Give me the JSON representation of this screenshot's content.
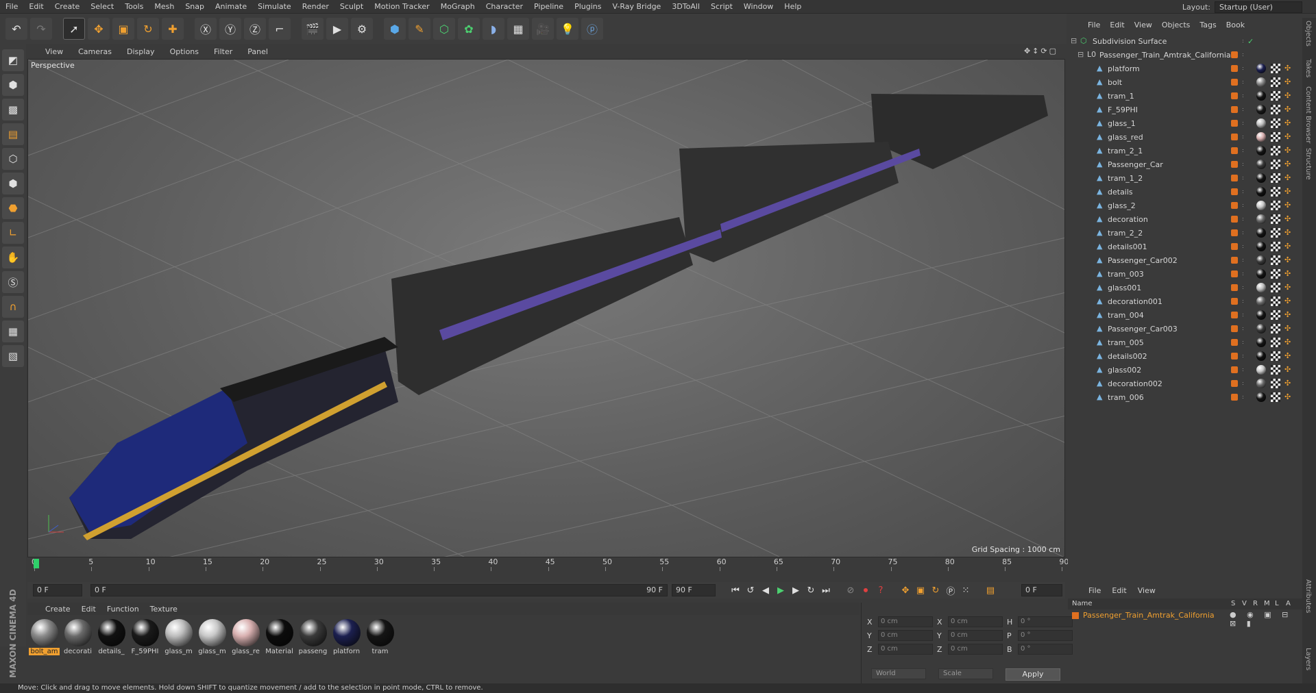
{
  "menubar": {
    "items": [
      "File",
      "Edit",
      "Create",
      "Select",
      "Tools",
      "Mesh",
      "Snap",
      "Animate",
      "Simulate",
      "Render",
      "Sculpt",
      "Motion Tracker",
      "MoGraph",
      "Character",
      "Pipeline",
      "Plugins",
      "V-Ray Bridge",
      "3DToAll",
      "Script",
      "Window",
      "Help"
    ],
    "layout_label": "Layout:",
    "layout_value": "Startup (User)"
  },
  "viewport": {
    "menu": [
      "View",
      "Cameras",
      "Display",
      "Options",
      "Filter",
      "Panel"
    ],
    "label": "Perspective",
    "grid_spacing": "Grid Spacing : 1000 cm"
  },
  "timeline": {
    "ticks": [
      "0",
      "5",
      "10",
      "15",
      "20",
      "25",
      "30",
      "35",
      "40",
      "45",
      "50",
      "55",
      "60",
      "65",
      "70",
      "75",
      "80",
      "85",
      "90"
    ],
    "current_frame_field": "0 F",
    "current_frame_right": "0 F",
    "range_start": "0 F",
    "range_end": "90 F",
    "range_end_field": "90 F"
  },
  "materials": {
    "menu": [
      "Create",
      "Edit",
      "Function",
      "Texture"
    ],
    "items": [
      {
        "label": "bolt_am",
        "color": "#8a8a8a"
      },
      {
        "label": "decorati",
        "color": "#6a6a6a"
      },
      {
        "label": "details_",
        "color": "#111111"
      },
      {
        "label": "F_59PHI",
        "color": "#1a1a1a"
      },
      {
        "label": "glass_m",
        "color": "#bdbdbd"
      },
      {
        "label": "glass_m",
        "color": "#c8c8c8"
      },
      {
        "label": "glass_re",
        "color": "#d8b0b0"
      },
      {
        "label": "Material",
        "color": "#0c0c0c"
      },
      {
        "label": "passeng",
        "color": "#3a3a3a"
      },
      {
        "label": "platforn",
        "color": "#1c2050"
      },
      {
        "label": "tram",
        "color": "#151515"
      }
    ]
  },
  "coords": {
    "rows": [
      {
        "a": "X",
        "v1": "0 cm",
        "b": "X",
        "v2": "0 cm",
        "c": "H",
        "v3": "0 °"
      },
      {
        "a": "Y",
        "v1": "0 cm",
        "b": "Y",
        "v2": "0 cm",
        "c": "P",
        "v3": "0 °"
      },
      {
        "a": "Z",
        "v1": "0 cm",
        "b": "Z",
        "v2": "0 cm",
        "c": "B",
        "v3": "0 °"
      }
    ],
    "world": "World",
    "scale": "Scale",
    "apply": "Apply"
  },
  "object_manager": {
    "menu": [
      "File",
      "Edit",
      "View",
      "Objects",
      "Tags",
      "Book"
    ],
    "root": "Subdivision Surface",
    "group": "Passenger_Train_Amtrak_California",
    "items": [
      {
        "name": "platform",
        "mat": "#1c2050"
      },
      {
        "name": "bolt",
        "mat": "#8a8a8a"
      },
      {
        "name": "tram_1",
        "mat": "#151515"
      },
      {
        "name": "F_59PHI",
        "mat": "#1a1a1a"
      },
      {
        "name": "glass_1",
        "mat": "#bdbdbd"
      },
      {
        "name": "glass_red",
        "mat": "#d8b0b0"
      },
      {
        "name": "tram_2_1",
        "mat": "#151515"
      },
      {
        "name": "Passenger_Car",
        "mat": "#3a3a3a"
      },
      {
        "name": "tram_1_2",
        "mat": "#151515"
      },
      {
        "name": "details",
        "mat": "#111111"
      },
      {
        "name": "glass_2",
        "mat": "#c8c8c8"
      },
      {
        "name": "decoration",
        "mat": "#6a6a6a"
      },
      {
        "name": "tram_2_2",
        "mat": "#151515"
      },
      {
        "name": "details001",
        "mat": "#111111"
      },
      {
        "name": "Passenger_Car002",
        "mat": "#3a3a3a"
      },
      {
        "name": "tram_003",
        "mat": "#151515"
      },
      {
        "name": "glass001",
        "mat": "#bdbdbd"
      },
      {
        "name": "decoration001",
        "mat": "#6a6a6a"
      },
      {
        "name": "tram_004",
        "mat": "#151515"
      },
      {
        "name": "Passenger_Car003",
        "mat": "#3a3a3a"
      },
      {
        "name": "tram_005",
        "mat": "#151515"
      },
      {
        "name": "details002",
        "mat": "#111111"
      },
      {
        "name": "glass002",
        "mat": "#c8c8c8"
      },
      {
        "name": "decoration002",
        "mat": "#6a6a6a"
      },
      {
        "name": "tram_006",
        "mat": "#151515"
      }
    ]
  },
  "layers": {
    "menu": [
      "File",
      "Edit",
      "View"
    ],
    "header_name": "Name",
    "header_cols": [
      "S",
      "V",
      "R",
      "M",
      "L",
      "A"
    ],
    "row": "Passenger_Train_Amtrak_California"
  },
  "right_tabs": [
    "Objects",
    "Takes",
    "Content Browser",
    "Structure",
    "Attributes",
    "Layers"
  ],
  "status": "Move: Click and drag to move elements. Hold down SHIFT to quantize movement / add to the selection in point mode, CTRL to remove.",
  "brand": "MAXON CINEMA 4D",
  "colors": {
    "accent": "#f0a030",
    "playhead": "#2fd06a",
    "ui_bg": "#3a3a3a"
  }
}
